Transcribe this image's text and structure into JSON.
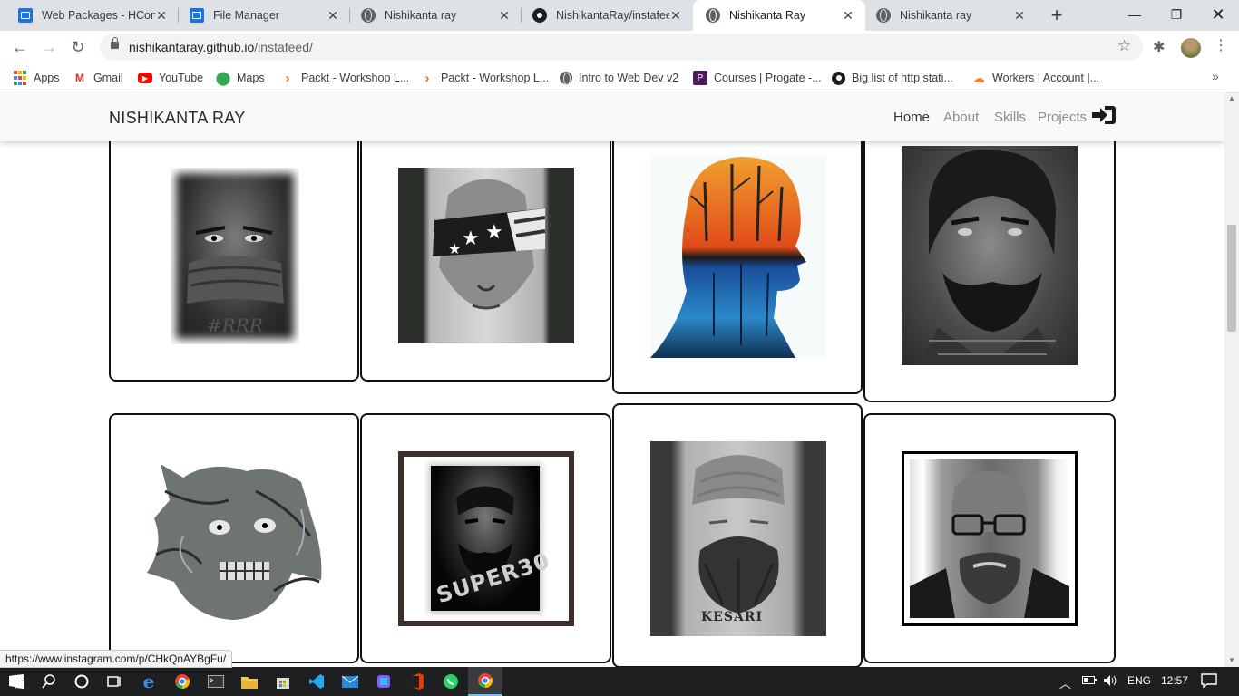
{
  "browser": {
    "tabs": [
      {
        "title": "Web Packages - HCons",
        "icon": "document-icon"
      },
      {
        "title": "File Manager",
        "icon": "document-icon"
      },
      {
        "title": "Nishikanta ray",
        "icon": "globe-icon"
      },
      {
        "title": "NishikantaRay/instafeed",
        "icon": "github-icon"
      },
      {
        "title": "Nishikanta Ray",
        "icon": "globe-icon",
        "active": true
      },
      {
        "title": "Nishikanta ray",
        "icon": "globe-icon"
      }
    ],
    "new_tab": "+",
    "url_host": "nishikantaray.github.io",
    "url_path": "/instafeed/",
    "bookmarks": [
      {
        "label": "Apps"
      },
      {
        "label": "Gmail"
      },
      {
        "label": "YouTube"
      },
      {
        "label": "Maps"
      },
      {
        "label": "Packt - Workshop L..."
      },
      {
        "label": "Packt - Workshop L..."
      },
      {
        "label": "Intro to Web Dev v2"
      },
      {
        "label": "Courses | Progate -..."
      },
      {
        "label": "Big list of http stati..."
      },
      {
        "label": "Workers | Account |..."
      }
    ],
    "status_url": "https://www.instagram.com/p/CHkQnAYBgFu/"
  },
  "site": {
    "brand": "NISHIKANTA RAY",
    "nav": [
      "Home",
      "About",
      "Skills",
      "Projects"
    ],
    "active_nav": "Home",
    "login_icon": "sign-in-icon"
  },
  "gallery": {
    "items": [
      {
        "subject": "masked-face-sketch",
        "caption": "#RRR"
      },
      {
        "subject": "blindfolded-girl-sketch",
        "caption": ""
      },
      {
        "subject": "silhouette-forest-painting",
        "caption": ""
      },
      {
        "subject": "bearded-man-sketch",
        "caption": ""
      },
      {
        "subject": "monster-face-sketch",
        "caption": ""
      },
      {
        "subject": "super30-portrait",
        "caption": "SUPER30"
      },
      {
        "subject": "kesari-portrait",
        "caption": "KESARI"
      },
      {
        "subject": "bald-man-glasses-sketch",
        "caption": ""
      }
    ]
  },
  "taskbar": {
    "lang": "ENG",
    "time": "12:57"
  },
  "colors": {
    "chrome_tab_bg": "#dee1e6",
    "card_border": "#111111",
    "taskbar_bg": "#1e1f21"
  }
}
